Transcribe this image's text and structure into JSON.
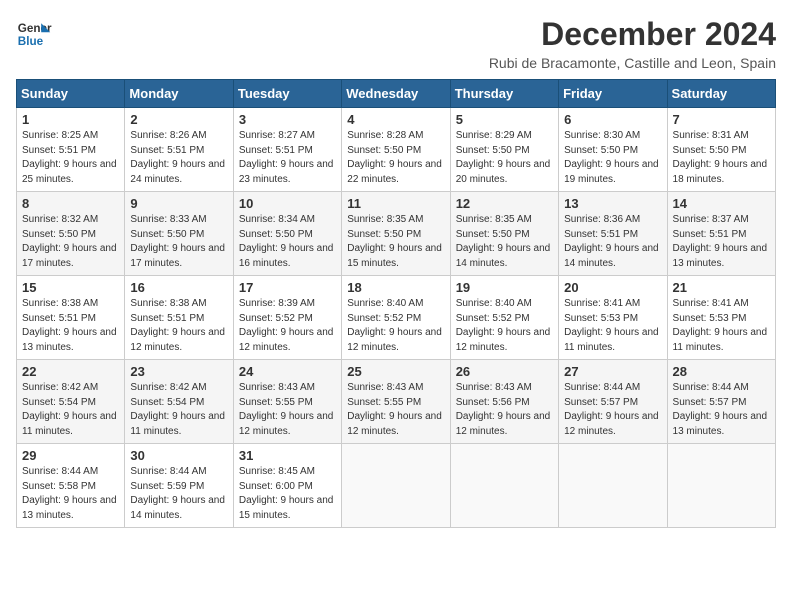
{
  "header": {
    "logo_line1": "General",
    "logo_line2": "Blue",
    "month_title": "December 2024",
    "location": "Rubi de Bracamonte, Castille and Leon, Spain"
  },
  "weekdays": [
    "Sunday",
    "Monday",
    "Tuesday",
    "Wednesday",
    "Thursday",
    "Friday",
    "Saturday"
  ],
  "weeks": [
    [
      {
        "day": "1",
        "sunrise": "8:25 AM",
        "sunset": "5:51 PM",
        "daylight": "9 hours and 25 minutes."
      },
      {
        "day": "2",
        "sunrise": "8:26 AM",
        "sunset": "5:51 PM",
        "daylight": "9 hours and 24 minutes."
      },
      {
        "day": "3",
        "sunrise": "8:27 AM",
        "sunset": "5:51 PM",
        "daylight": "9 hours and 23 minutes."
      },
      {
        "day": "4",
        "sunrise": "8:28 AM",
        "sunset": "5:50 PM",
        "daylight": "9 hours and 22 minutes."
      },
      {
        "day": "5",
        "sunrise": "8:29 AM",
        "sunset": "5:50 PM",
        "daylight": "9 hours and 20 minutes."
      },
      {
        "day": "6",
        "sunrise": "8:30 AM",
        "sunset": "5:50 PM",
        "daylight": "9 hours and 19 minutes."
      },
      {
        "day": "7",
        "sunrise": "8:31 AM",
        "sunset": "5:50 PM",
        "daylight": "9 hours and 18 minutes."
      }
    ],
    [
      {
        "day": "8",
        "sunrise": "8:32 AM",
        "sunset": "5:50 PM",
        "daylight": "9 hours and 17 minutes."
      },
      {
        "day": "9",
        "sunrise": "8:33 AM",
        "sunset": "5:50 PM",
        "daylight": "9 hours and 17 minutes."
      },
      {
        "day": "10",
        "sunrise": "8:34 AM",
        "sunset": "5:50 PM",
        "daylight": "9 hours and 16 minutes."
      },
      {
        "day": "11",
        "sunrise": "8:35 AM",
        "sunset": "5:50 PM",
        "daylight": "9 hours and 15 minutes."
      },
      {
        "day": "12",
        "sunrise": "8:35 AM",
        "sunset": "5:50 PM",
        "daylight": "9 hours and 14 minutes."
      },
      {
        "day": "13",
        "sunrise": "8:36 AM",
        "sunset": "5:51 PM",
        "daylight": "9 hours and 14 minutes."
      },
      {
        "day": "14",
        "sunrise": "8:37 AM",
        "sunset": "5:51 PM",
        "daylight": "9 hours and 13 minutes."
      }
    ],
    [
      {
        "day": "15",
        "sunrise": "8:38 AM",
        "sunset": "5:51 PM",
        "daylight": "9 hours and 13 minutes."
      },
      {
        "day": "16",
        "sunrise": "8:38 AM",
        "sunset": "5:51 PM",
        "daylight": "9 hours and 12 minutes."
      },
      {
        "day": "17",
        "sunrise": "8:39 AM",
        "sunset": "5:52 PM",
        "daylight": "9 hours and 12 minutes."
      },
      {
        "day": "18",
        "sunrise": "8:40 AM",
        "sunset": "5:52 PM",
        "daylight": "9 hours and 12 minutes."
      },
      {
        "day": "19",
        "sunrise": "8:40 AM",
        "sunset": "5:52 PM",
        "daylight": "9 hours and 12 minutes."
      },
      {
        "day": "20",
        "sunrise": "8:41 AM",
        "sunset": "5:53 PM",
        "daylight": "9 hours and 11 minutes."
      },
      {
        "day": "21",
        "sunrise": "8:41 AM",
        "sunset": "5:53 PM",
        "daylight": "9 hours and 11 minutes."
      }
    ],
    [
      {
        "day": "22",
        "sunrise": "8:42 AM",
        "sunset": "5:54 PM",
        "daylight": "9 hours and 11 minutes."
      },
      {
        "day": "23",
        "sunrise": "8:42 AM",
        "sunset": "5:54 PM",
        "daylight": "9 hours and 11 minutes."
      },
      {
        "day": "24",
        "sunrise": "8:43 AM",
        "sunset": "5:55 PM",
        "daylight": "9 hours and 12 minutes."
      },
      {
        "day": "25",
        "sunrise": "8:43 AM",
        "sunset": "5:55 PM",
        "daylight": "9 hours and 12 minutes."
      },
      {
        "day": "26",
        "sunrise": "8:43 AM",
        "sunset": "5:56 PM",
        "daylight": "9 hours and 12 minutes."
      },
      {
        "day": "27",
        "sunrise": "8:44 AM",
        "sunset": "5:57 PM",
        "daylight": "9 hours and 12 minutes."
      },
      {
        "day": "28",
        "sunrise": "8:44 AM",
        "sunset": "5:57 PM",
        "daylight": "9 hours and 13 minutes."
      }
    ],
    [
      {
        "day": "29",
        "sunrise": "8:44 AM",
        "sunset": "5:58 PM",
        "daylight": "9 hours and 13 minutes."
      },
      {
        "day": "30",
        "sunrise": "8:44 AM",
        "sunset": "5:59 PM",
        "daylight": "9 hours and 14 minutes."
      },
      {
        "day": "31",
        "sunrise": "8:45 AM",
        "sunset": "6:00 PM",
        "daylight": "9 hours and 15 minutes."
      },
      null,
      null,
      null,
      null
    ]
  ]
}
